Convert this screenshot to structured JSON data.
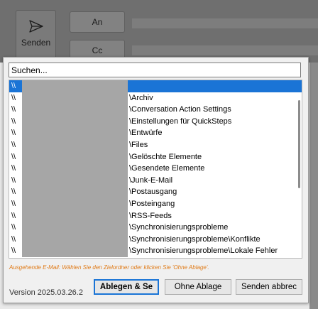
{
  "compose": {
    "send_label": "Senden",
    "to_label": "An",
    "cc_label": "Cc"
  },
  "dialog": {
    "search": {
      "placeholder": "Suchen..."
    },
    "folders": [
      {
        "prefix": "\\\\",
        "path": "",
        "selected": true
      },
      {
        "prefix": "\\\\",
        "path": "\\Archiv"
      },
      {
        "prefix": "\\\\",
        "path": "\\Conversation Action Settings"
      },
      {
        "prefix": "\\\\",
        "path": "\\Einstellungen für QuickSteps"
      },
      {
        "prefix": "\\\\",
        "path": "\\Entwürfe"
      },
      {
        "prefix": "\\\\",
        "path": "\\Files"
      },
      {
        "prefix": "\\\\",
        "path": "\\Gelöschte Elemente"
      },
      {
        "prefix": "\\\\",
        "path": "\\Gesendete Elemente"
      },
      {
        "prefix": "\\\\",
        "path": "\\Junk-E-Mail"
      },
      {
        "prefix": "\\\\",
        "path": "\\Postausgang"
      },
      {
        "prefix": "\\\\",
        "path": "\\Posteingang"
      },
      {
        "prefix": "\\\\",
        "path": "\\RSS-Feeds"
      },
      {
        "prefix": "\\\\",
        "path": "\\Synchronisierungsprobleme"
      },
      {
        "prefix": "\\\\",
        "path": "\\Synchronisierungsprobleme\\Konflikte"
      },
      {
        "prefix": "\\\\",
        "path": "\\Synchronisierungsprobleme\\Lokale Fehler"
      }
    ],
    "hint": "Ausgehende E-Mail: Wählen Sie den Zielordner oder klicken Sie 'Ohne Ablage'.",
    "version": "Version 2025.03.26.2",
    "buttons": {
      "file_send": "Ablegen & Se",
      "no_file": "Ohne Ablage",
      "send_cancel": "Senden abbrec"
    },
    "colors": {
      "selection": "#1a74d6",
      "hint": "#e07b18"
    }
  }
}
